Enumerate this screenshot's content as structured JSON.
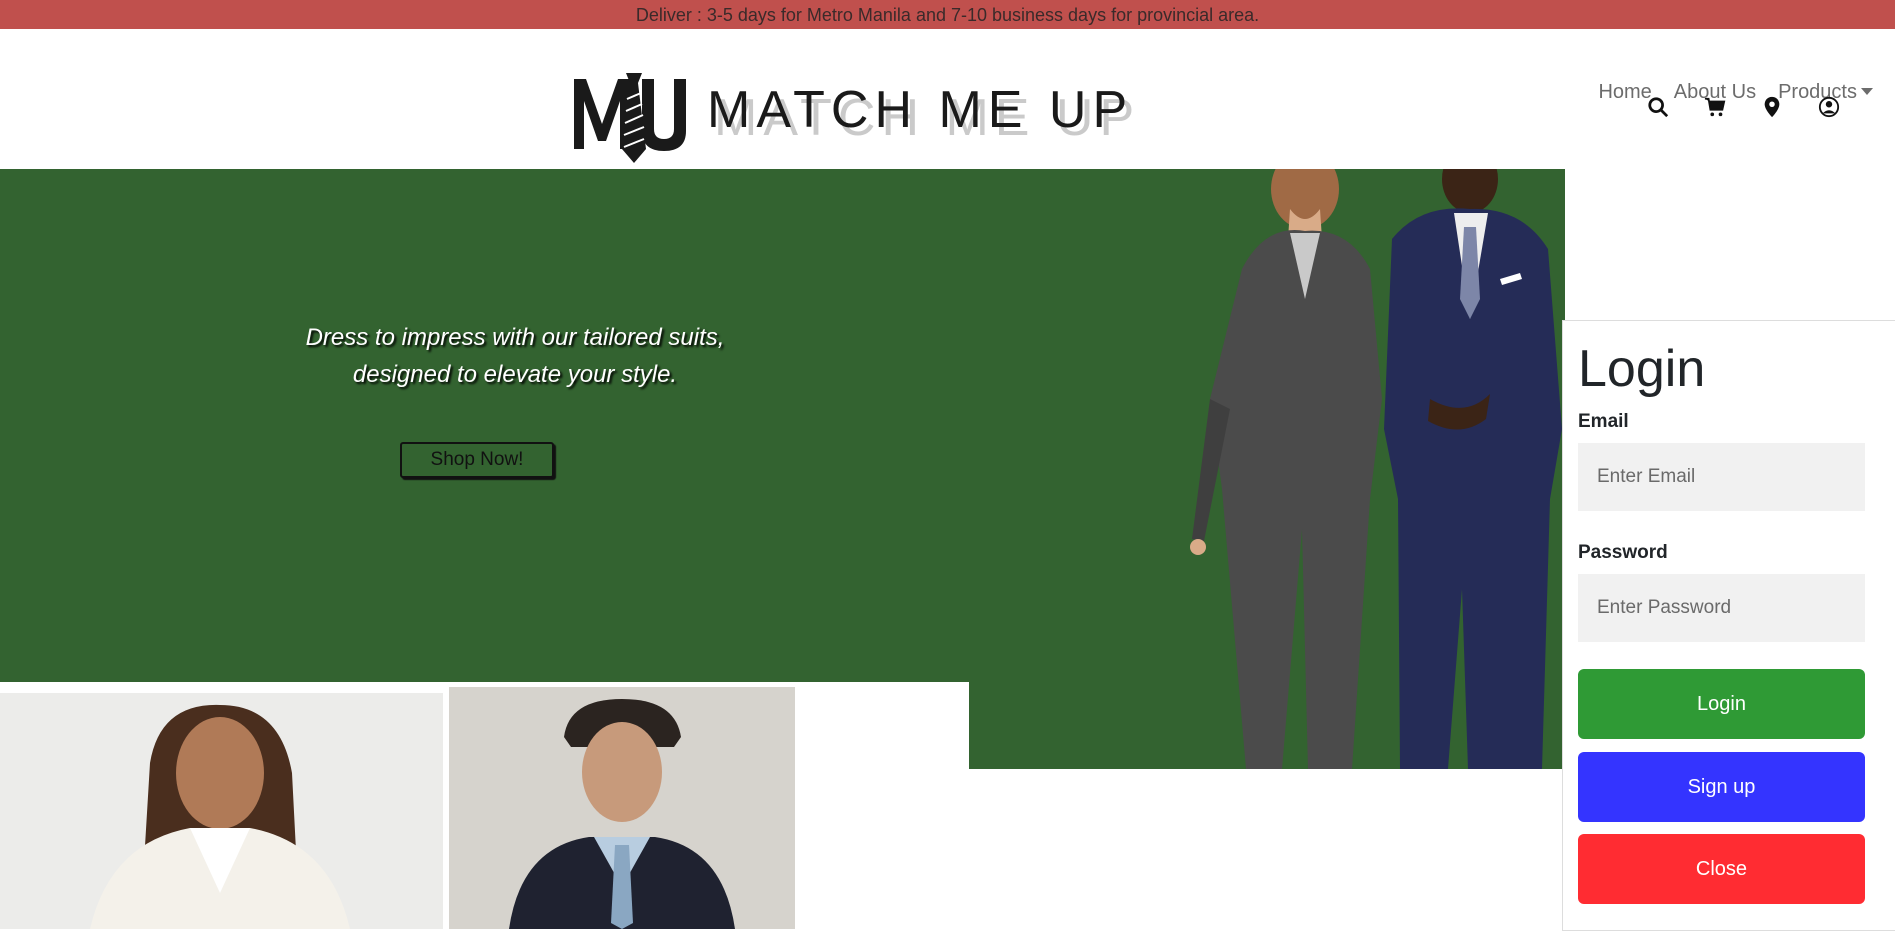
{
  "announcement": "Deliver : 3-5 days for Metro Manila and 7-10 business days for provincial area.",
  "brand": {
    "mark": "MU",
    "name": "MATCH ME UP"
  },
  "nav": {
    "home": "Home",
    "about": "About Us",
    "products": "Products"
  },
  "icons": [
    "search-icon",
    "cart-icon",
    "location-icon",
    "user-icon"
  ],
  "hero": {
    "line1": "Dress to impress with our tailored suits,",
    "line2": "designed to elevate your style.",
    "cta": "Shop Now!"
  },
  "login": {
    "title": "Login",
    "email_label": "Email",
    "email_placeholder": "Enter Email",
    "password_label": "Password",
    "password_placeholder": "Enter Password",
    "login_label": "Login",
    "signup_label": "Sign up",
    "close_label": "Close"
  },
  "colors": {
    "topbar": "#c0504d",
    "hero": "#336330",
    "login_button": "#2f9a35",
    "signup_button": "#3434ff",
    "close_button": "#ff2c32"
  }
}
